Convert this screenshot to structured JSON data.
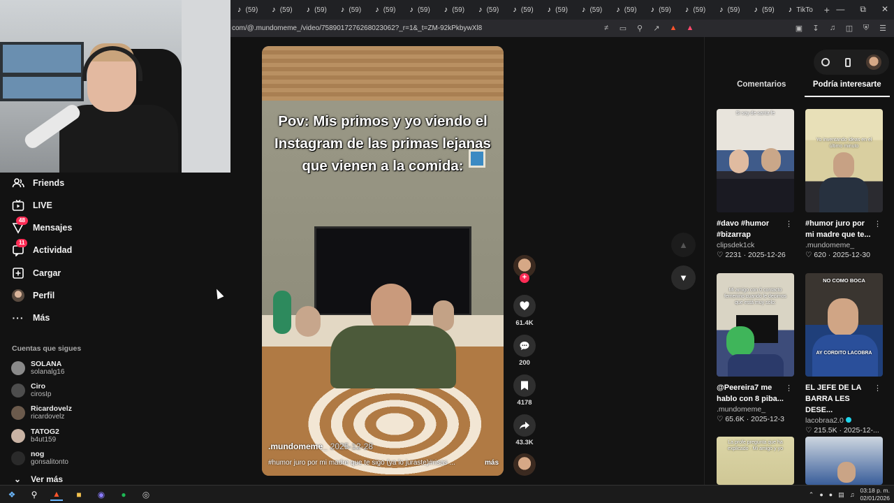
{
  "browser": {
    "tab_label": "(59)",
    "tab_count": 17,
    "last_tab_label": "TikTo",
    "url": "com/@.mundomeme_/video/7589017276268023062?_r=1&_t=ZM-92kPkbywXl8"
  },
  "sidebar": {
    "items": [
      {
        "label": "Friends",
        "icon": "friends-icon"
      },
      {
        "label": "LIVE",
        "icon": "live-icon"
      },
      {
        "label": "Mensajes",
        "icon": "messages-icon",
        "badge": "48"
      },
      {
        "label": "Actividad",
        "icon": "activity-icon",
        "badge": "11"
      },
      {
        "label": "Cargar",
        "icon": "upload-icon"
      },
      {
        "label": "Perfil",
        "icon": "profile-avatar"
      },
      {
        "label": "Más",
        "icon": "more-icon"
      }
    ],
    "following_title": "Cuentas que sigues",
    "following": [
      {
        "name": "SOLANA",
        "user": "solanalg16"
      },
      {
        "name": "Ciro",
        "user": "cirosIp"
      },
      {
        "name": "Ricardovelz",
        "user": "ricardovelz"
      },
      {
        "name": "TATOG2",
        "user": "b4ut159"
      },
      {
        "name": "nog",
        "user": "gonsalitonto"
      }
    ],
    "see_more": "Ver más"
  },
  "video": {
    "caption": "Pov: Mis primos y yo viendo el Instagram de las primas lejanas que vienen a la comida:",
    "author": ".mundomeme_",
    "date": "2025-12-28",
    "description": "#humor juro por mi madre que te sigo (ya lo juraste)#risas ...",
    "more_label": "más"
  },
  "actions": {
    "likes": "61.4K",
    "comments": "200",
    "saves": "4178",
    "shares": "43.3K"
  },
  "right_panel": {
    "tabs": [
      "Comentarios",
      "Podría interesarte"
    ],
    "active_tab": 1,
    "cards": [
      {
        "title": "#davo #humor #bizarrap",
        "author": "clipsdek1ck",
        "likes": "2231",
        "date": "2025-12-26",
        "overlay": "Si soy de santa fe",
        "verified": false
      },
      {
        "title": "#humor juro por mi madre que te...",
        "author": ".mundomeme_",
        "likes": "620",
        "date": "2025-12-30",
        "overlay": "Yo inventando ideas en el último minuto",
        "verified": false
      },
      {
        "title": "@Peereira7 me hablo con 8 piba...",
        "author": ".mundomeme_",
        "likes": "65.6K",
        "date": "2025-12-3",
        "overlay": "Mi amigo con 0 contacto femenino cuando le decimos que está muy solo:",
        "verified": false
      },
      {
        "title": "EL JEFE DE LA BARRA LES DESE...",
        "author": "lacobraa2.0",
        "likes": "215.5K",
        "date": "2025-12-...",
        "overlay": "NO COMO BOCA",
        "banner": "AY CORDITO LACOBRA",
        "verified": true
      },
      {
        "title": "",
        "author": "",
        "likes": "",
        "date": "",
        "overlay": "La profe pregunta que ha explicado · Mi amigo y yo",
        "verified": false
      },
      {
        "title": "",
        "author": "",
        "likes": "",
        "date": "",
        "overlay": "",
        "verified": false
      }
    ]
  },
  "taskbar": {
    "time": "03:18 p. m.",
    "date": "02/01/2026"
  }
}
